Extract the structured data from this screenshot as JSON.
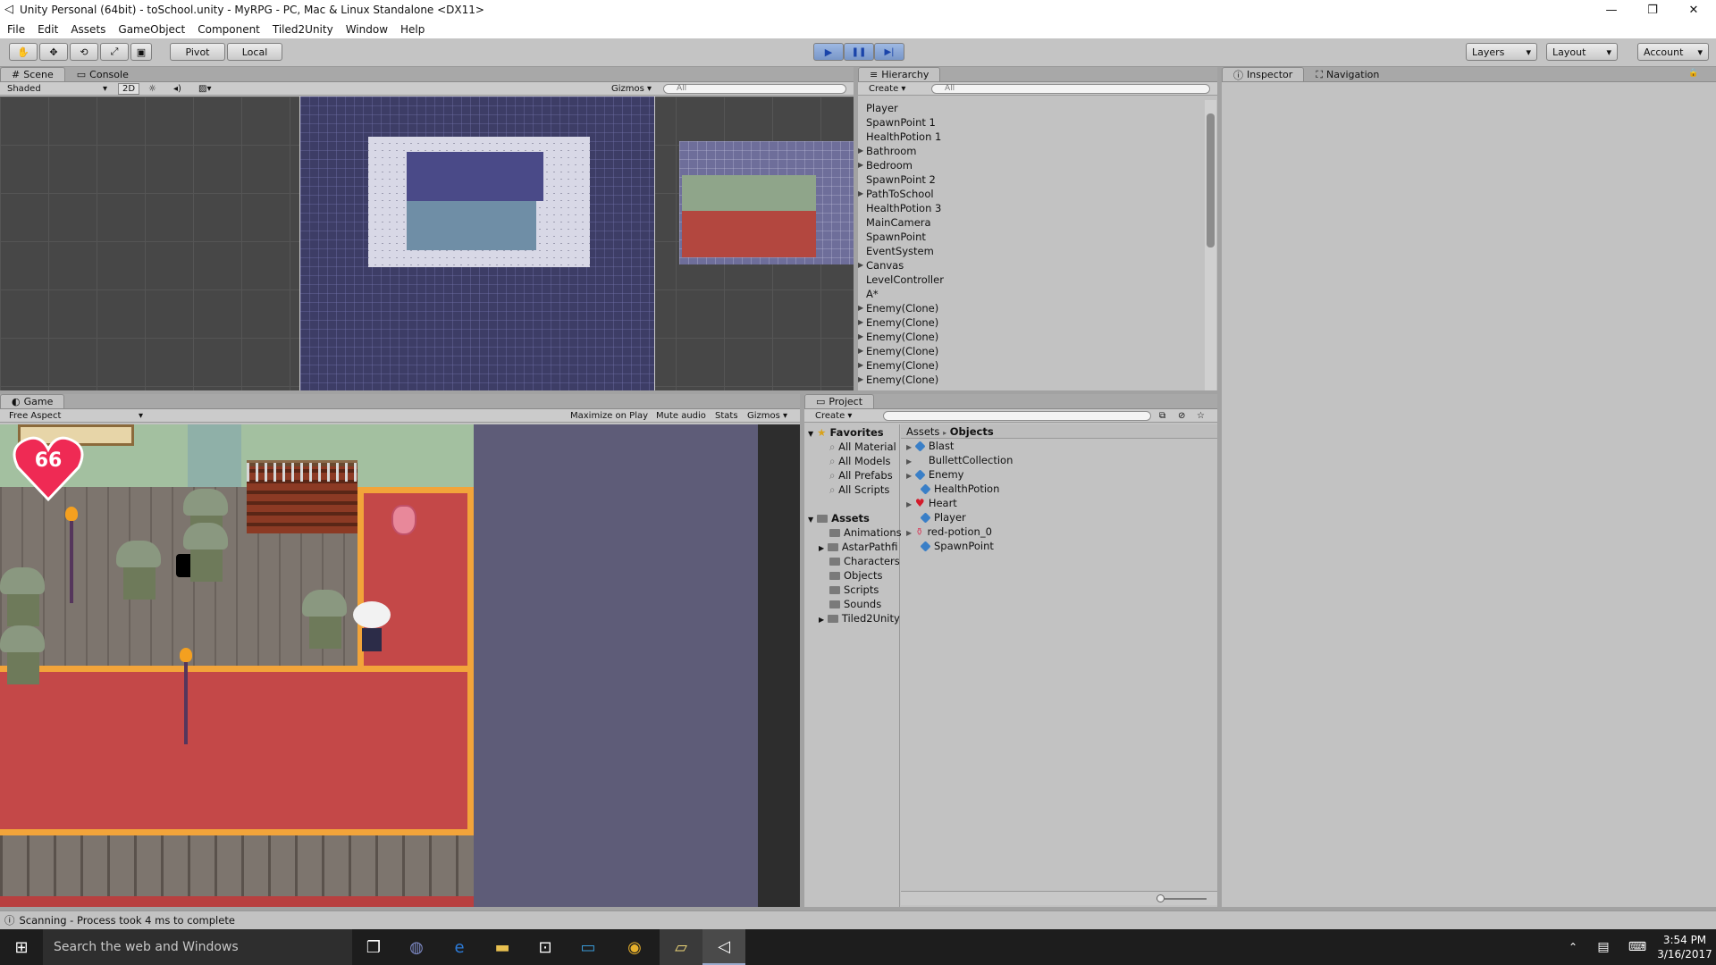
{
  "window": {
    "title": "Unity Personal (64bit) - toSchool.unity - MyRPG - PC, Mac & Linux Standalone <DX11>",
    "minimize": "—",
    "restore": "❐",
    "close": "✕"
  },
  "menu": [
    "File",
    "Edit",
    "Assets",
    "GameObject",
    "Component",
    "Tiled2Unity",
    "Window",
    "Help"
  ],
  "toolbar": {
    "pivot": "Pivot",
    "local": "Local",
    "play": "▶",
    "pause": "❚❚",
    "step": "▶|",
    "layers": "Layers",
    "layout": "Layout",
    "account": "Account"
  },
  "scene": {
    "tab": "Scene",
    "console_tab": "Console",
    "shading": "Shaded",
    "mode_2d": "2D",
    "gizmos": "Gizmos",
    "search": "All"
  },
  "hierarchy": {
    "tab": "Hierarchy",
    "create": "Create",
    "search": "All",
    "items": [
      {
        "label": "Player",
        "expandable": false
      },
      {
        "label": "SpawnPoint 1",
        "expandable": false
      },
      {
        "label": "HealthPotion 1",
        "expandable": false
      },
      {
        "label": "Bathroom",
        "expandable": true
      },
      {
        "label": "Bedroom",
        "expandable": true
      },
      {
        "label": "SpawnPoint 2",
        "expandable": false
      },
      {
        "label": "PathToSchool",
        "expandable": true
      },
      {
        "label": "HealthPotion 3",
        "expandable": false
      },
      {
        "label": "MainCamera",
        "expandable": false
      },
      {
        "label": "SpawnPoint",
        "expandable": false
      },
      {
        "label": "EventSystem",
        "expandable": false
      },
      {
        "label": "Canvas",
        "expandable": true
      },
      {
        "label": "LevelController",
        "expandable": false
      },
      {
        "label": "A*",
        "expandable": false
      },
      {
        "label": "Enemy(Clone)",
        "expandable": true
      },
      {
        "label": "Enemy(Clone)",
        "expandable": true
      },
      {
        "label": "Enemy(Clone)",
        "expandable": true
      },
      {
        "label": "Enemy(Clone)",
        "expandable": true
      },
      {
        "label": "Enemy(Clone)",
        "expandable": true
      },
      {
        "label": "Enemy(Clone)",
        "expandable": true
      }
    ]
  },
  "inspector": {
    "tab": "Inspector",
    "navigation_tab": "Navigation"
  },
  "game": {
    "tab": "Game",
    "aspect": "Free Aspect",
    "maximize": "Maximize on Play",
    "mute": "Mute audio",
    "stats": "Stats",
    "gizmos": "Gizmos",
    "health": "66"
  },
  "project": {
    "tab": "Project",
    "create": "Create",
    "breadcrumb_root": "Assets",
    "breadcrumb_sep": "▸",
    "breadcrumb_current": "Objects",
    "favorites_label": "Favorites",
    "favorites": [
      "All Material",
      "All Models",
      "All Prefabs",
      "All Scripts"
    ],
    "assets_label": "Assets",
    "folders": [
      "Animations",
      "AstarPathfi",
      "Characters",
      "Objects",
      "Scripts",
      "Sounds",
      "Tiled2Unity"
    ],
    "objects": [
      {
        "label": "Blast",
        "icon": "cube"
      },
      {
        "label": "BullettCollection",
        "icon": "none"
      },
      {
        "label": "Enemy",
        "icon": "cube"
      },
      {
        "label": "HealthPotion",
        "icon": "cube"
      },
      {
        "label": "Heart",
        "icon": "heart"
      },
      {
        "label": "Player",
        "icon": "cube"
      },
      {
        "label": "red-potion_0",
        "icon": "sprite"
      },
      {
        "label": "SpawnPoint",
        "icon": "cube"
      }
    ]
  },
  "status": {
    "text": "Scanning - Process took 4 ms to complete"
  },
  "taskbar": {
    "search": "Search the web and Windows",
    "time": "3:54 PM",
    "date": "3/16/2017"
  },
  "colors": {
    "game_bg": "#5e5c78",
    "carpet": "#c44848",
    "carpet_border": "#f2a43a",
    "scene_bg": "#474747"
  }
}
